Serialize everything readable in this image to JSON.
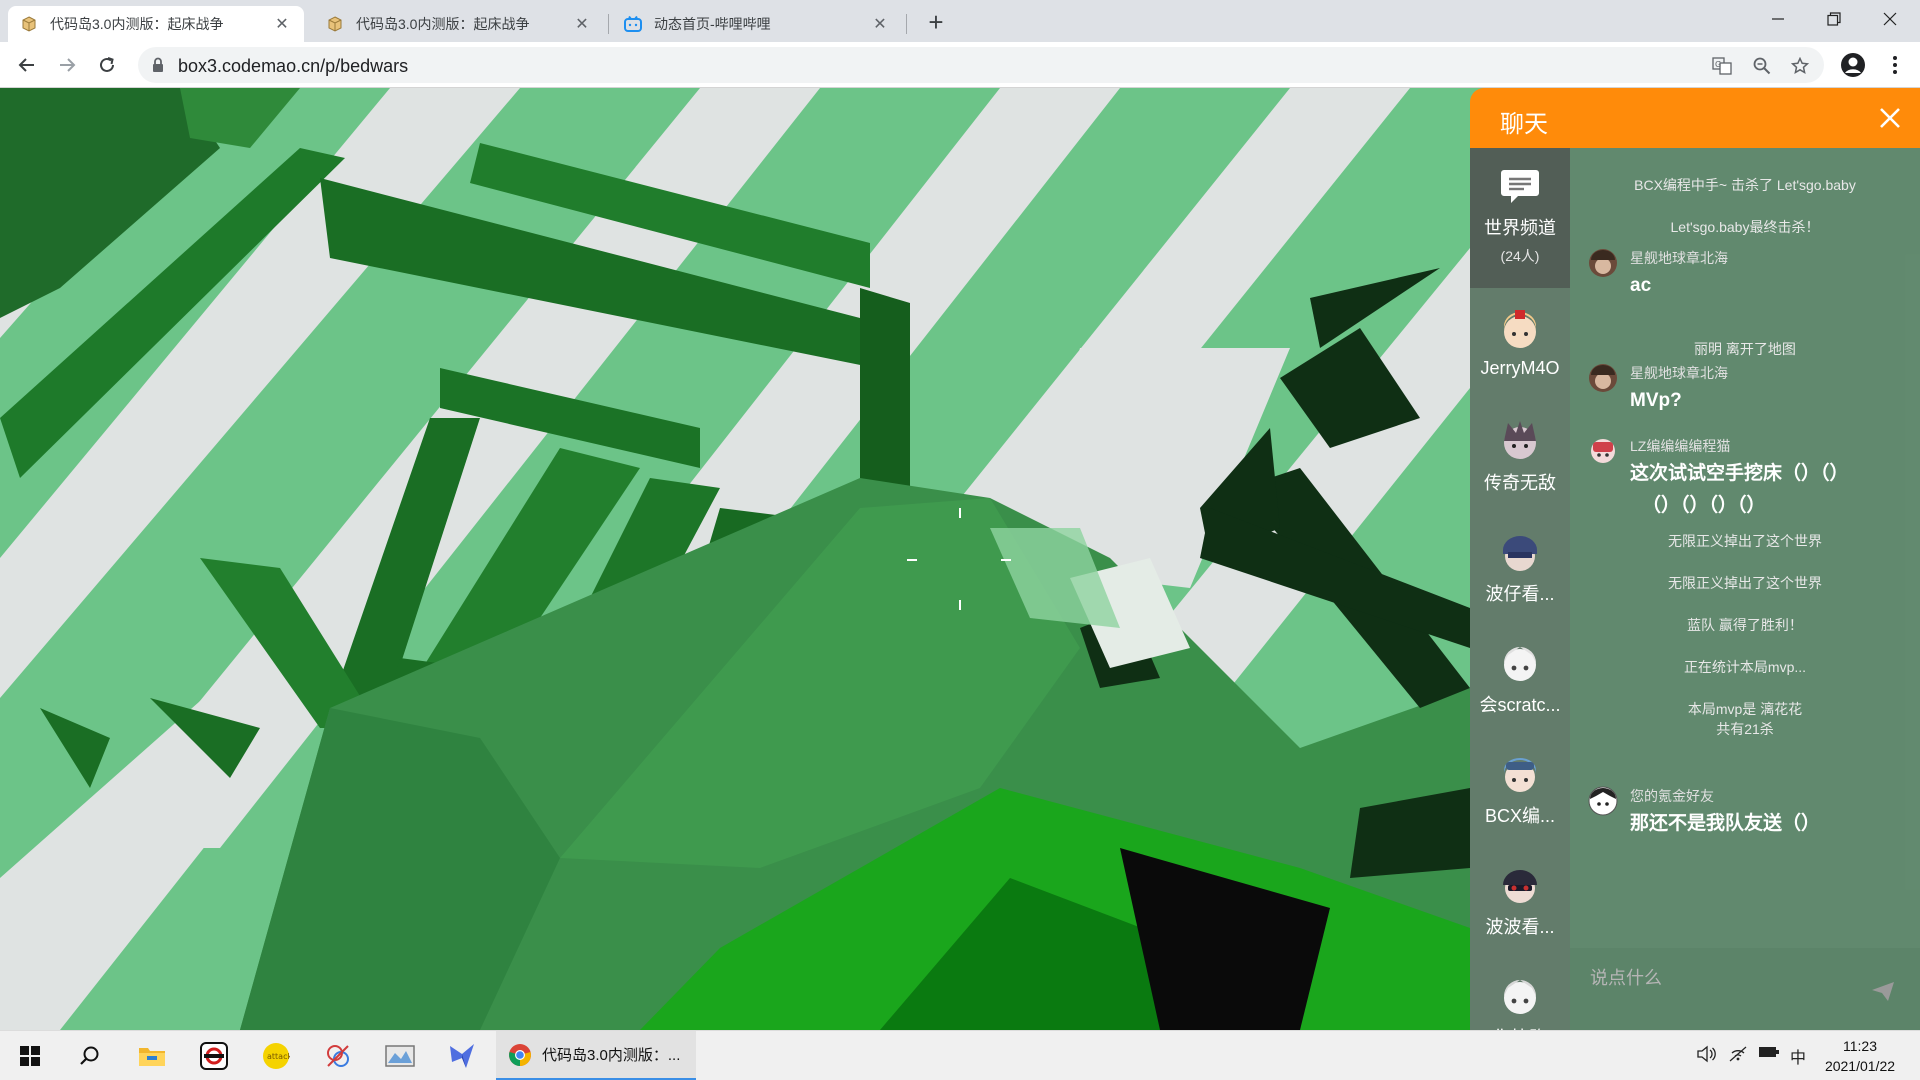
{
  "browser": {
    "tabs": [
      {
        "title": "代码岛3.0内测版：起床战争",
        "icon": "box-favicon-icon",
        "active": true
      },
      {
        "title": "代码岛3.0内测版：起床战争",
        "icon": "box-favicon-icon",
        "active": false
      },
      {
        "title": "动态首页-哔哩哔哩",
        "icon": "bilibili-favicon-icon",
        "active": false
      }
    ],
    "url": "box3.codemao.cn/p/bedwars"
  },
  "chat": {
    "title": "聊天",
    "channel": {
      "name": "世界频道",
      "count": "(24人)"
    },
    "users": [
      {
        "name": "JerryM4O",
        "avatar_color": "#f2c98a"
      },
      {
        "name": "传奇无敌",
        "avatar_color": "#7a6a78"
      },
      {
        "name": "波仔看...",
        "avatar_color": "#3b4a7a"
      },
      {
        "name": "会scratc...",
        "avatar_color": "#e8e8e8"
      },
      {
        "name": "BCX编...",
        "avatar_color": "#6aa0d0"
      },
      {
        "name": "波波看...",
        "avatar_color": "#2a2a3a"
      },
      {
        "name": "你快跑",
        "avatar_color": "#dddddd"
      }
    ],
    "system_messages": [
      "BCX编程中手~ 击杀了 Let'sgo.baby",
      "Let'sgo.baby最终击杀！",
      "丽明 离开了地图",
      "无限正义掉出了这个世界",
      "无限正义掉出了这个世界",
      "蓝队 赢得了胜利！",
      "正在统计本局mvp...",
      "本局mvp是 漓花花",
      "共有21杀"
    ],
    "messages": [
      {
        "user": "星舰地球章北海",
        "text": "ac",
        "avatar_color": "#6b4a3a"
      },
      {
        "user": "星舰地球章北海",
        "text": "MVp?",
        "avatar_color": "#6b4a3a"
      },
      {
        "user": "LZ编编编编程猫",
        "text": "这次试试空手挖床（）（）",
        "text_line2": "（）（）（）（）",
        "avatar_color": "#d0404a"
      },
      {
        "user": "您的氪金好友",
        "text": "那还不是我队友送（）",
        "avatar_color": "#f0f0f0"
      }
    ],
    "input_placeholder": "说点什么"
  },
  "taskbar": {
    "chrome_label": "代码岛3.0内测版：...",
    "ime": "中",
    "time": "11:23",
    "date": "2021/01/22"
  }
}
